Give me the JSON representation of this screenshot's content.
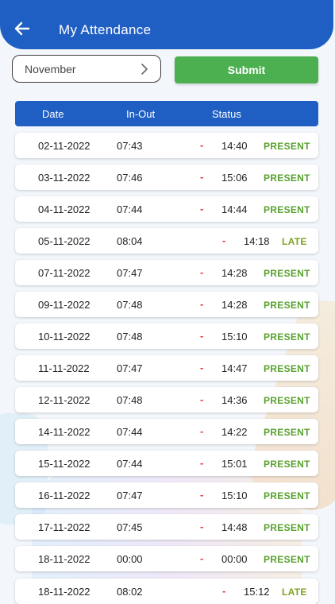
{
  "header": {
    "title": "My Attendance"
  },
  "filter": {
    "month": "November",
    "submit_label": "Submit"
  },
  "table": {
    "columns": {
      "date": "Date",
      "inout": "In-Out",
      "status": "Status"
    },
    "rows": [
      {
        "date": "02-11-2022",
        "in": "07:43",
        "dash": "-",
        "out": "14:40",
        "status": "PRESENT"
      },
      {
        "date": "03-11-2022",
        "in": "07:46",
        "dash": "-",
        "out": "15:06",
        "status": "PRESENT"
      },
      {
        "date": "04-11-2022",
        "in": "07:44",
        "dash": "-",
        "out": "14:44",
        "status": "PRESENT"
      },
      {
        "date": "05-11-2022",
        "in": "08:04",
        "dash": "-",
        "out": "14:18",
        "status": "LATE"
      },
      {
        "date": "07-11-2022",
        "in": "07:47",
        "dash": "-",
        "out": "14:28",
        "status": "PRESENT"
      },
      {
        "date": "09-11-2022",
        "in": "07:48",
        "dash": "-",
        "out": "14:28",
        "status": "PRESENT"
      },
      {
        "date": "10-11-2022",
        "in": "07:48",
        "dash": "-",
        "out": "15:10",
        "status": "PRESENT"
      },
      {
        "date": "11-11-2022",
        "in": "07:47",
        "dash": "-",
        "out": "14:47",
        "status": "PRESENT"
      },
      {
        "date": "12-11-2022",
        "in": "07:48",
        "dash": "-",
        "out": "14:36",
        "status": "PRESENT"
      },
      {
        "date": "14-11-2022",
        "in": "07:44",
        "dash": "-",
        "out": "14:22",
        "status": "PRESENT"
      },
      {
        "date": "15-11-2022",
        "in": "07:44",
        "dash": "-",
        "out": "15:01",
        "status": "PRESENT"
      },
      {
        "date": "16-11-2022",
        "in": "07:47",
        "dash": "-",
        "out": "15:10",
        "status": "PRESENT"
      },
      {
        "date": "17-11-2022",
        "in": "07:45",
        "dash": "-",
        "out": "14:48",
        "status": "PRESENT"
      },
      {
        "date": "18-11-2022",
        "in": "00:00",
        "dash": "-",
        "out": "00:00",
        "status": "PRESENT"
      },
      {
        "date": "18-11-2022",
        "in": "08:02",
        "dash": "-",
        "out": "15:12",
        "status": "LATE"
      }
    ]
  },
  "colors": {
    "primary": "#1f5fc4",
    "submit": "#4caf50",
    "present": "#5aa12f",
    "dash": "#e53935"
  },
  "icons": {
    "back": "arrow-left-icon",
    "month_chevron": "chevron-right-icon"
  }
}
